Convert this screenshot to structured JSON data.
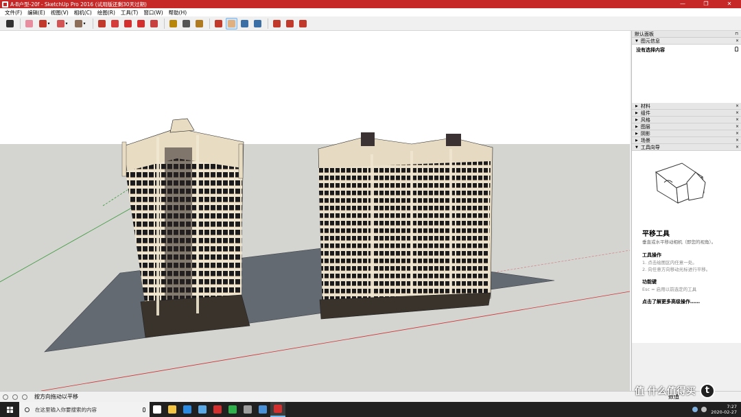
{
  "window": {
    "title": "A-B户型-20f - SketchUp Pro 2016   (试用版还剩30天过期)",
    "minimize": "—",
    "maximize": "❐",
    "close": "✕"
  },
  "menu": [
    "文件(F)",
    "编辑(E)",
    "视图(V)",
    "相机(C)",
    "绘图(R)",
    "工具(T)",
    "窗口(W)",
    "帮助(H)"
  ],
  "toolbar": {
    "tools": [
      {
        "name": "select-tool",
        "color": "#333333"
      },
      {
        "name": "eraser-tool",
        "color": "#e88ca0"
      },
      {
        "name": "pencil-tool",
        "color": "#c0392b",
        "dropdown": true
      },
      {
        "name": "arc-tool",
        "color": "#d35454",
        "dropdown": true
      },
      {
        "name": "rectangle-tool",
        "color": "#8c6e5a",
        "dropdown": true
      },
      {
        "name": "push-pull-tool",
        "color": "#c0392b"
      },
      {
        "name": "follow-me-tool",
        "color": "#d63b3b"
      },
      {
        "name": "move-tool",
        "color": "#d32f2f"
      },
      {
        "name": "rotate-tool",
        "color": "#d32f2f"
      },
      {
        "name": "scale-tool",
        "color": "#c94040"
      },
      {
        "name": "tape-measure-tool",
        "color": "#b8860b"
      },
      {
        "name": "text-tool",
        "color": "#555555"
      },
      {
        "name": "paint-bucket-tool",
        "color": "#b07a20"
      },
      {
        "name": "orbit-tool",
        "color": "#c0392b"
      },
      {
        "name": "pan-tool",
        "color": "#e0b080",
        "active": true
      },
      {
        "name": "zoom-tool",
        "color": "#3a6ea5"
      },
      {
        "name": "zoom-extents-tool",
        "color": "#3a6ea5"
      },
      {
        "name": "warehouse-tool",
        "color": "#c0392b"
      },
      {
        "name": "extension-warehouse-tool",
        "color": "#c0392b"
      },
      {
        "name": "layout-tool",
        "color": "#c0392b"
      }
    ]
  },
  "tray": {
    "title": "默认面板",
    "pin": "⊓",
    "entity_info": {
      "title": "图元信息",
      "empty": "没有选择内容"
    },
    "panels": [
      "材料",
      "组件",
      "风格",
      "图层",
      "阴影",
      "场景",
      "工具向导"
    ],
    "instructor": {
      "tool_name": "平移工具",
      "description": "垂直或水平移动相机（即您的视角）。",
      "ops_title": "工具操作",
      "ops": [
        "1. 点击绘图区内任意一处。",
        "2. 向任意方向移动光标进行平移。"
      ],
      "keys_title": "功能键",
      "keys": [
        "Esc = 启用以前选定的工具"
      ],
      "more": "点击了解更多高级操作……"
    }
  },
  "status": {
    "hint": "按方向拖动以平移",
    "measure": "数值"
  },
  "taskbar": {
    "search_placeholder": "在这里输入你要搜索的内容",
    "apps": [
      {
        "name": "task-view",
        "color": "#ffffff"
      },
      {
        "name": "file-explorer",
        "color": "#f4c542"
      },
      {
        "name": "edge-browser",
        "color": "#2b8ae2"
      },
      {
        "name": "qq-browser",
        "color": "#5aa9e6"
      },
      {
        "name": "autocad",
        "color": "#d32f2f"
      },
      {
        "name": "wechat",
        "color": "#2fb04a"
      },
      {
        "name": "app-circle",
        "color": "#9e9e9e"
      },
      {
        "name": "app-blue",
        "color": "#4a90d9"
      },
      {
        "name": "sketchup",
        "color": "#d32f2f",
        "active": true
      }
    ],
    "time": "7:27",
    "date": "2020-02-27"
  },
  "watermark": {
    "text": "值 什么值得买",
    "badge": "t"
  }
}
